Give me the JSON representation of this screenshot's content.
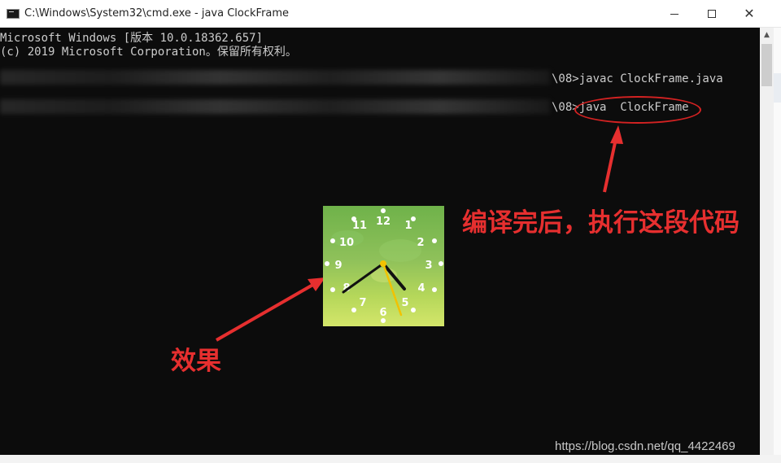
{
  "window": {
    "title": "C:\\Windows\\System32\\cmd.exe - java   ClockFrame",
    "icon": "cmd-icon",
    "minimize_icon": "minimize-icon",
    "maximize_icon": "maximize-icon",
    "close_icon": "close-icon",
    "close_glyph": "✕"
  },
  "console": {
    "line1": "Microsoft Windows [版本 10.0.18362.657]",
    "line2": "(c) 2019 Microsoft Corporation。保留所有权利。",
    "cmd1": "\\08>javac ClockFrame.java",
    "cmd2": "\\08>java  ClockFrame",
    "background": "#0c0c0c",
    "foreground": "#cccccc"
  },
  "annotations": {
    "main_note": "编译完后，执行这段代码",
    "effect_note": "效果",
    "color": "#e62f2f"
  },
  "clock": {
    "numbers": [
      "12",
      "1",
      "2",
      "3",
      "4",
      "5",
      "6",
      "7",
      "8",
      "9",
      "10",
      "11"
    ],
    "hour_hand_color": "#111111",
    "minute_hand_color": "#111111",
    "second_hand_color": "#f2c200"
  },
  "scrollbar": {
    "up_glyph": "▲"
  },
  "watermark": "https://blog.csdn.net/qq_4422469"
}
